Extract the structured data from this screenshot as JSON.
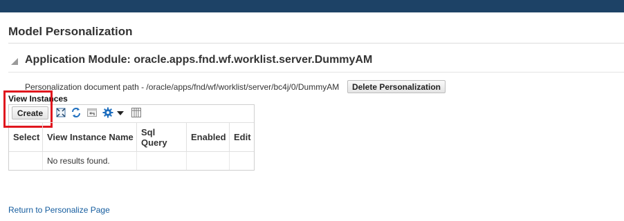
{
  "page_title": "Model Personalization",
  "section": {
    "title": "Application Module: oracle.apps.fnd.wf.worklist.server.DummyAM",
    "doc_path": "Personalization document path - /oracle/apps/fnd/wf/worklist/server/bc4j/0/DummyAM",
    "delete_button": "Delete Personalization"
  },
  "view_instances": {
    "label": "View Instances",
    "create_button": "Create",
    "toolbar_icons": [
      "detach-icon",
      "refresh-icon",
      "revert-icon",
      "gear-icon",
      "dropdown-caret-icon",
      "columns-icon"
    ],
    "columns": [
      "Select",
      "View Instance Name",
      "Sql Query",
      "Enabled",
      "Edit"
    ],
    "empty_message": "No results found."
  },
  "return_link": "Return to Personalize Page",
  "colors": {
    "topbar": "#1d4266",
    "link": "#145c9e",
    "highlight": "#e0161e"
  }
}
